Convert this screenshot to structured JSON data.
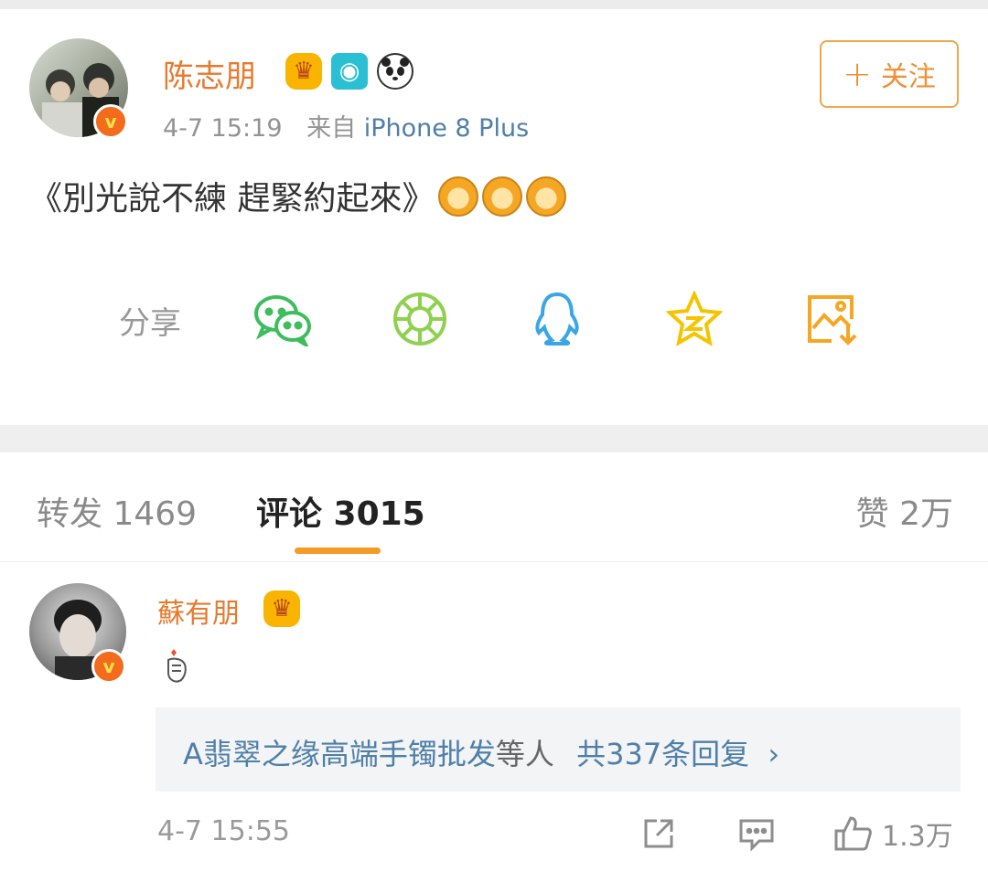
{
  "post": {
    "author": "陈志朋",
    "time": "4-7 15:19",
    "source_prefix": "来自",
    "source": "iPhone 8 Plus",
    "follow_label": "关注",
    "text": "《別光說不練 趕緊約起來》",
    "badges": [
      "crown-icon",
      "camera-icon",
      "panda-icon"
    ]
  },
  "share": {
    "label": "分享",
    "targets": [
      "wechat-icon",
      "moments-icon",
      "qq-icon",
      "qzone-icon",
      "save-image-icon"
    ],
    "colors": {
      "wechat": "#3ebd5e",
      "moments": "#8fd14f",
      "qq": "#3aa6e8",
      "qzone": "#f5c400",
      "save": "#f5a623"
    }
  },
  "tabs": {
    "repost": "转发 1469",
    "comments": "评论 3015",
    "likes": "赞 2万"
  },
  "comment": {
    "author": "蘇有朋",
    "reply_users": "A翡翠之缘高端手镯批发",
    "reply_mid": "等人",
    "reply_count": "共337条回复",
    "reply_arrow": "›",
    "time": "4-7 15:55",
    "like_count": "1.3万"
  },
  "colors": {
    "accent_orange": "#e8792d",
    "link_blue": "#4e7fa8",
    "tab_underline": "#f59a23"
  }
}
